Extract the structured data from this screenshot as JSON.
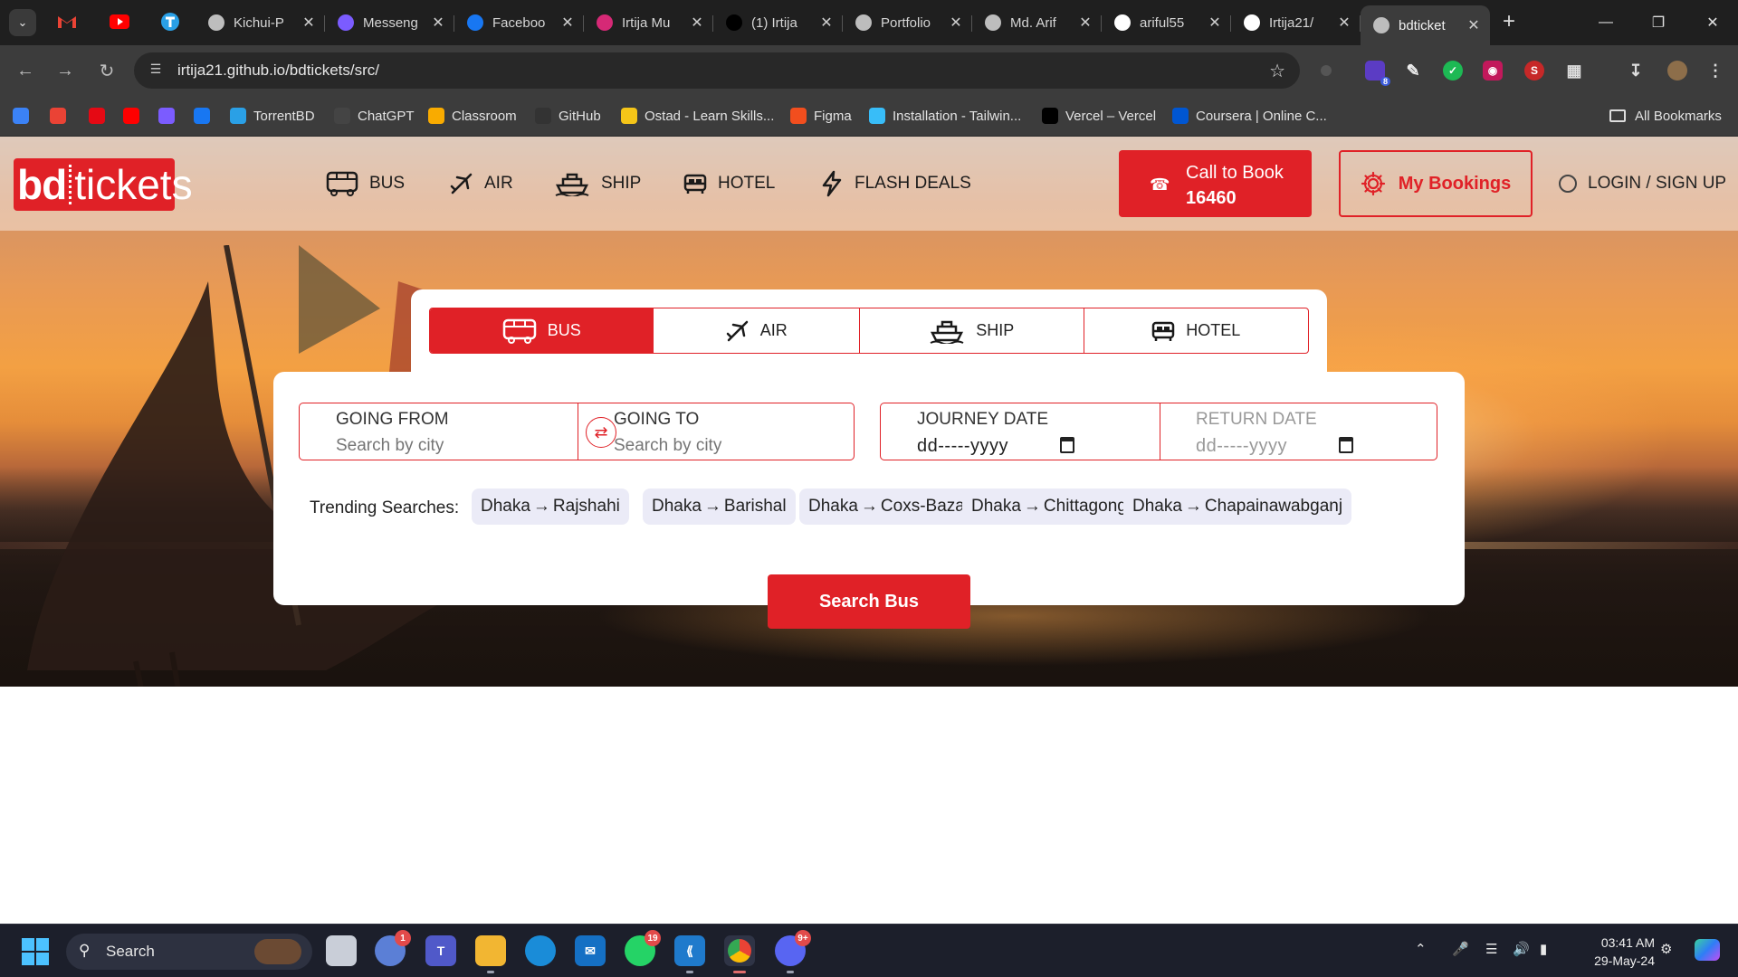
{
  "browser": {
    "tabs": [
      {
        "title": "Kichui-P",
        "favicon_color": "#bdbdbd"
      },
      {
        "title": "Messeng",
        "favicon_color": "#7b5cff"
      },
      {
        "title": "Faceboo",
        "favicon_color": "#1877f2"
      },
      {
        "title": "Irtija Mu",
        "favicon_color": "#d62976"
      },
      {
        "title": "(1) Irtija",
        "favicon_color": "#000000"
      },
      {
        "title": "Portfolio",
        "favicon_color": "#bdbdbd"
      },
      {
        "title": "Md. Arif",
        "favicon_color": "#bdbdbd"
      },
      {
        "title": "ariful55",
        "favicon_color": "#ffffff"
      },
      {
        "title": "Irtija21/",
        "favicon_color": "#ffffff"
      },
      {
        "title": "bdticket",
        "favicon_color": "#bdbdbd",
        "active": true
      }
    ],
    "url": "irtija21.github.io/bdtickets/src/",
    "bookmarks": [
      {
        "label": "",
        "color": "#3b82f6"
      },
      {
        "label": "",
        "color": "#ea4335"
      },
      {
        "label": "",
        "color": "#e50914"
      },
      {
        "label": "",
        "color": "#ff0000"
      },
      {
        "label": "",
        "color": "#7b5cff"
      },
      {
        "label": "",
        "color": "#1877f2"
      },
      {
        "label": "TorrentBD",
        "color": "#2aa0e6"
      },
      {
        "label": "ChatGPT",
        "color": "#444444"
      },
      {
        "label": "Classroom",
        "color": "#f9ab00"
      },
      {
        "label": "GitHub",
        "color": "#333333"
      },
      {
        "label": "Ostad - Learn Skills...",
        "color": "#f5c518"
      },
      {
        "label": "Figma",
        "color": "#f24e1e"
      },
      {
        "label": "Installation - Tailwin...",
        "color": "#38bdf8"
      },
      {
        "label": "Vercel – Vercel",
        "color": "#000000"
      },
      {
        "label": "Coursera | Online C...",
        "color": "#0056d2"
      }
    ],
    "all_bookmarks": "All Bookmarks",
    "extension_badge": "8"
  },
  "site": {
    "logo_bold": "bd",
    "logo_light": "tickets",
    "nav": [
      "BUS",
      "AIR",
      "SHIP",
      "HOTEL",
      "FLASH DEALS"
    ],
    "call": {
      "line1": "Call to Book",
      "line2": "16460"
    },
    "my_bookings": "My Bookings",
    "login": "LOGIN / SIGN UP",
    "brand_color": "#e02127"
  },
  "search": {
    "mode_tabs": [
      "BUS",
      "AIR",
      "SHIP",
      "HOTEL"
    ],
    "active_mode": "BUS",
    "from_label": "GOING FROM",
    "from_placeholder": "Search by city",
    "to_label": "GOING TO",
    "to_placeholder": "Search by city",
    "journey_label": "JOURNEY DATE",
    "journey_value": "dd-----yyyy",
    "return_label": "RETURN DATE",
    "return_value": "dd-----yyyy",
    "trending_label": "Trending Searches:",
    "trending": [
      {
        "from": "Dhaka",
        "to": "Rajshahi"
      },
      {
        "from": "Dhaka",
        "to": "Barishal"
      },
      {
        "from": "Dhaka",
        "to": "Coxs-Bazar"
      },
      {
        "from": "Dhaka",
        "to": "Chittagong"
      },
      {
        "from": "Dhaka",
        "to": "Chapainawabganj"
      }
    ],
    "button": "Search Bus"
  },
  "taskbar": {
    "search": "Search",
    "badges": {
      "weather": "1",
      "whatsapp": "19",
      "discord": "9+"
    },
    "time": "03:41 AM",
    "date": "29-May-24"
  }
}
